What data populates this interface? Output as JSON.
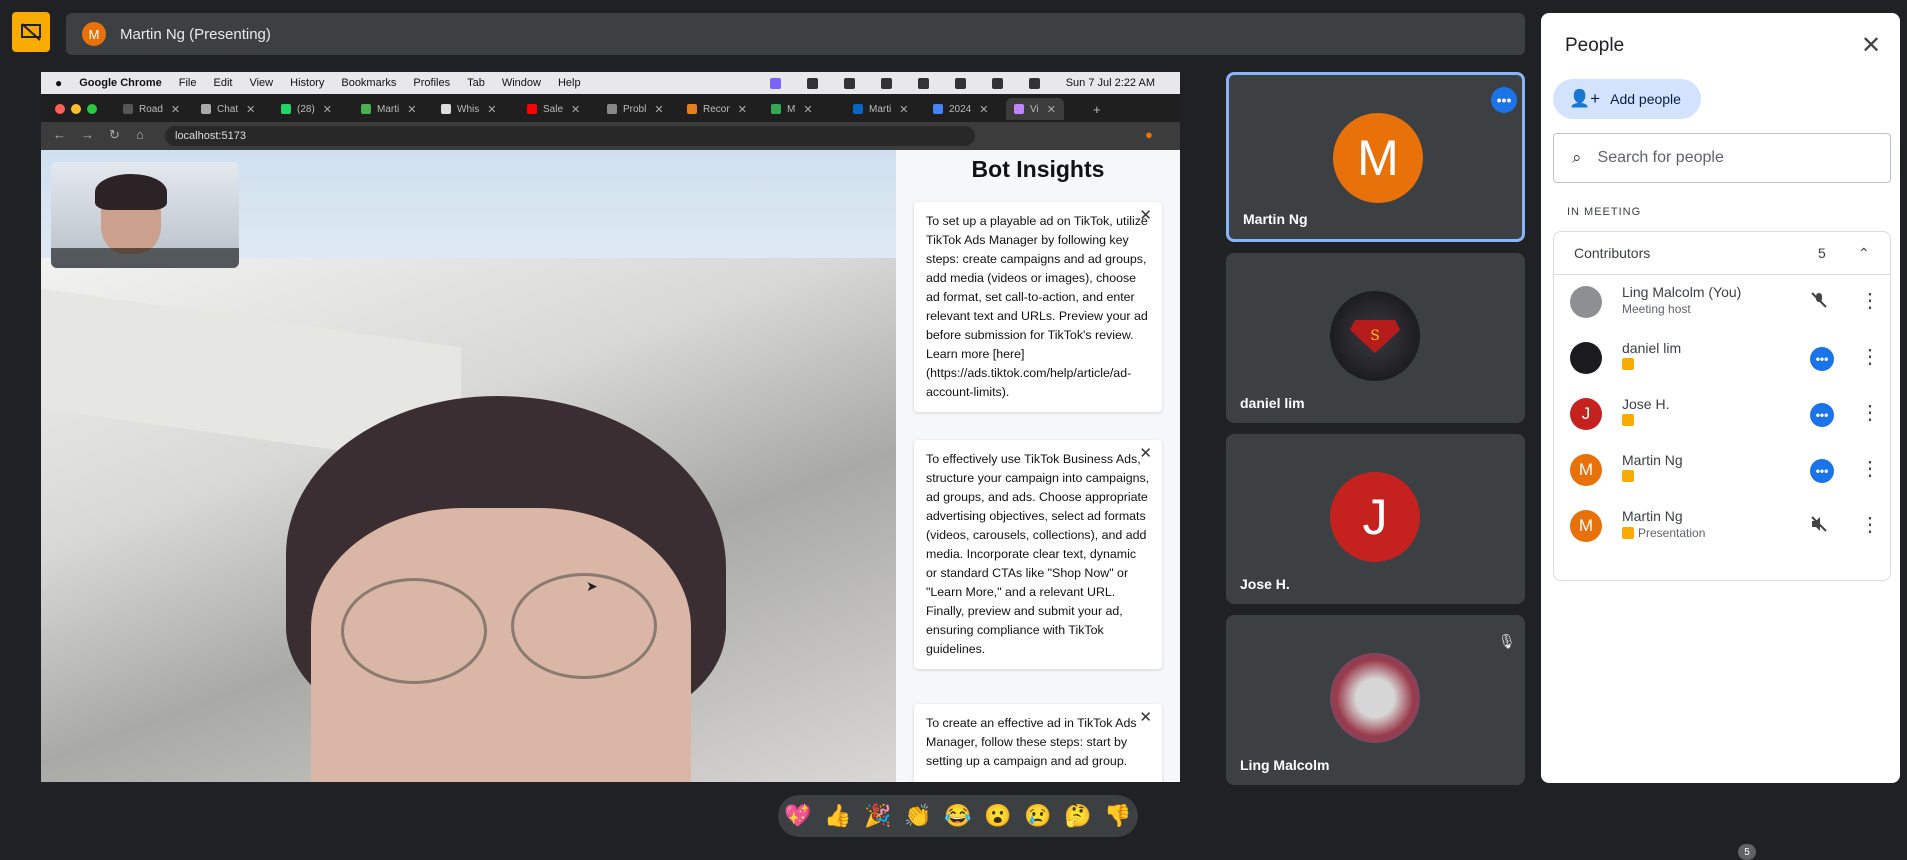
{
  "presenting": {
    "avatar_letter": "M",
    "title": "Martin Ng (Presenting)"
  },
  "shared_screen": {
    "mac_menu": [
      "Google Chrome",
      "File",
      "Edit",
      "View",
      "History",
      "Bookmarks",
      "Profiles",
      "Tab",
      "Window",
      "Help"
    ],
    "clock": "Sun 7 Jul  2:22 AM",
    "tabs": [
      "Road",
      "Chat",
      "(28)",
      "Marti",
      "Whis",
      "Sale",
      "Probl",
      "Recor",
      "M",
      "Marti",
      "2024",
      "Vi"
    ],
    "url": "localhost:5173",
    "insights_title": "Bot Insights",
    "cards": [
      "To set up a playable ad on TikTok, utilize TikTok Ads Manager by following key steps: create campaigns and ad groups, add media (videos or images), choose ad format, set call-to-action, and enter relevant text and URLs. Preview your ad before submission for TikTok's review. Learn more [here](https://ads.tiktok.com/help/article/ad-account-limits).",
      "To effectively use TikTok Business Ads, structure your campaign into campaigns, ad groups, and ads. Choose appropriate advertising objectives, select ad formats (videos, carousels, collections), and add media. Incorporate clear text, dynamic or standard CTAs like \"Shop Now\" or \"Learn More,\" and a relevant URL. Finally, preview and submit your ad, ensuring compliance with TikTok guidelines.",
      "To create an effective ad in TikTok Ads Manager, follow these steps: start by setting up a campaign and ad group."
    ]
  },
  "tiles": [
    {
      "name": "Martin Ng",
      "letter": "M",
      "color": "#e8710a"
    },
    {
      "name": "daniel lim",
      "letter": "",
      "color": "#1b1b1f"
    },
    {
      "name": "Jose H.",
      "letter": "J",
      "color": "#c5221f"
    },
    {
      "name": "Ling Malcolm",
      "letter": "",
      "color": "#7b8794"
    }
  ],
  "people_panel": {
    "title": "People",
    "add_people": "Add people",
    "search_placeholder": "Search for people",
    "section_label": "IN MEETING",
    "group_label": "Contributors",
    "group_count": "5",
    "participants": [
      {
        "name": "Ling Malcolm (You)",
        "sub": "Meeting host",
        "letter": "",
        "color": "#8d8f93",
        "action": "mic-off-icon"
      },
      {
        "name": "daniel lim",
        "sub": "",
        "letter": "",
        "color": "#1b1b1f",
        "action": "more-options-icon"
      },
      {
        "name": "Jose H.",
        "sub": "",
        "letter": "J",
        "color": "#c5221f",
        "action": "more-options-icon"
      },
      {
        "name": "Martin Ng",
        "sub": "",
        "letter": "M",
        "color": "#e8710a",
        "action": "more-options-icon"
      },
      {
        "name": "Martin Ng",
        "sub": "Presentation",
        "letter": "M",
        "color": "#e8710a",
        "action": "sound-off-icon"
      }
    ]
  },
  "reactions": [
    "💖",
    "👍",
    "🎉",
    "👏",
    "😂",
    "😮",
    "😢",
    "🤔",
    "👎"
  ],
  "bottom_badge": "5"
}
